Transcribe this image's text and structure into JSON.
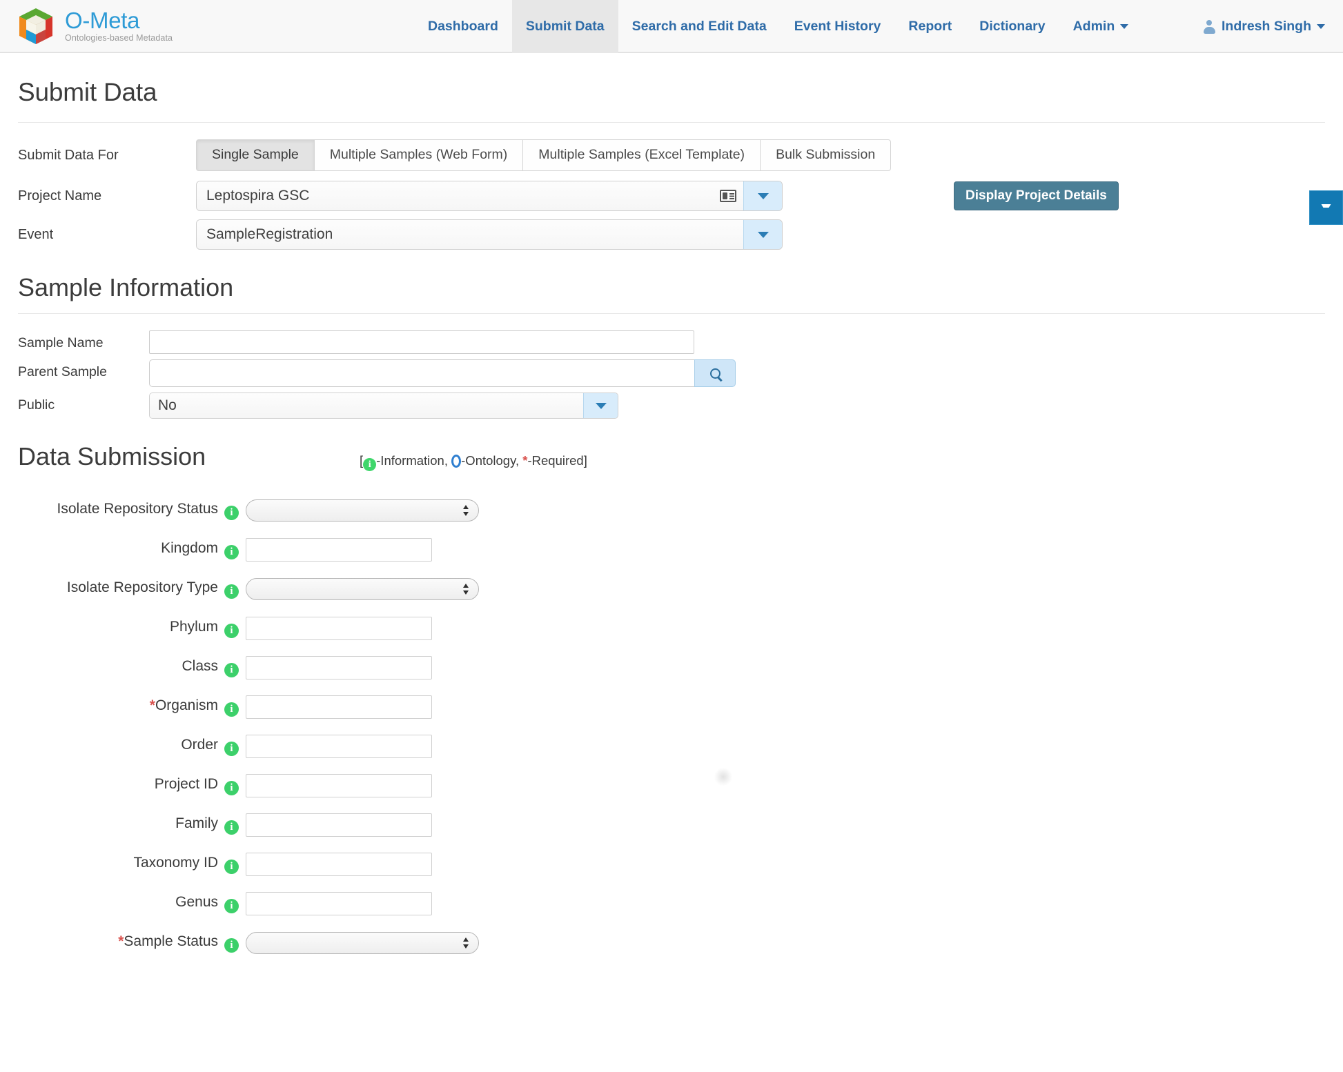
{
  "brand": {
    "title": "O-Meta",
    "subtitle": "Ontologies-based Metadata",
    "logo_colors": {
      "green": "#5aa832",
      "red": "#d6352b",
      "orange": "#f08a1c",
      "blue": "#1f9ad6",
      "cream": "#f2efe2"
    }
  },
  "nav": {
    "items": [
      {
        "label": "Dashboard",
        "active": false
      },
      {
        "label": "Submit Data",
        "active": true
      },
      {
        "label": "Search and Edit Data",
        "active": false
      },
      {
        "label": "Event History",
        "active": false
      },
      {
        "label": "Report",
        "active": false
      },
      {
        "label": "Dictionary",
        "active": false
      },
      {
        "label": "Admin",
        "active": false,
        "has_caret": true
      }
    ],
    "user": {
      "name": "Indresh Singh",
      "icon": "user-icon",
      "has_caret": true
    },
    "link_color": "#2f6ca8",
    "active_bg": "#e7e7e7"
  },
  "page": {
    "title": "Submit Data",
    "collapse_button": {
      "icon": "chevron-down-icon",
      "color": "#1279b3"
    }
  },
  "submit_for": {
    "label": "Submit Data For",
    "tabs": [
      {
        "label": "Single Sample",
        "selected": true
      },
      {
        "label": "Multiple Samples (Web Form)",
        "selected": false
      },
      {
        "label": "Multiple Samples (Excel Template)",
        "selected": false
      },
      {
        "label": "Bulk Submission",
        "selected": false
      }
    ]
  },
  "project": {
    "label": "Project Name",
    "value": "Leptospira GSC",
    "picker_icon": "contact-card-icon",
    "dropdown_icon": "caret-down-icon",
    "details_button": "Display Project Details",
    "details_button_color": "#4b7f96"
  },
  "event": {
    "label": "Event",
    "value": "SampleRegistration",
    "dropdown_icon": "caret-down-icon"
  },
  "sample_information": {
    "title": "Sample Information",
    "sample_name": {
      "label": "Sample Name",
      "value": ""
    },
    "parent_sample": {
      "label": "Parent Sample",
      "value": "",
      "search_icon": "search-icon"
    },
    "public": {
      "label": "Public",
      "value": "No",
      "dropdown_icon": "caret-down-icon"
    }
  },
  "data_submission": {
    "title": "Data Submission",
    "legend": {
      "open_bracket": "[",
      "info_icon": "info-icon",
      "info_text": "-Information,",
      "ontology_icon": "ontology-icon",
      "ontology_text": "-Ontology,",
      "required_mark": "*",
      "required_text": "-Required]"
    },
    "fields": [
      {
        "label": "Isolate Repository Status",
        "required": false,
        "type": "select",
        "value": "",
        "info_icon": "info-icon"
      },
      {
        "label": "Kingdom",
        "required": false,
        "type": "text",
        "value": "",
        "info_icon": "info-icon"
      },
      {
        "label": "Isolate Repository Type",
        "required": false,
        "type": "select",
        "value": "",
        "info_icon": "info-icon"
      },
      {
        "label": "Phylum",
        "required": false,
        "type": "text",
        "value": "",
        "info_icon": "info-icon"
      },
      {
        "label": "Class",
        "required": false,
        "type": "text",
        "value": "",
        "info_icon": "info-icon"
      },
      {
        "label": "Organism",
        "required": true,
        "type": "text",
        "value": "",
        "info_icon": "info-icon"
      },
      {
        "label": "Order",
        "required": false,
        "type": "text",
        "value": "",
        "info_icon": "info-icon"
      },
      {
        "label": "Project ID",
        "required": false,
        "type": "text",
        "value": "",
        "info_icon": "info-icon"
      },
      {
        "label": "Family",
        "required": false,
        "type": "text",
        "value": "",
        "info_icon": "info-icon"
      },
      {
        "label": "Taxonomy ID",
        "required": false,
        "type": "text",
        "value": "",
        "info_icon": "info-icon"
      },
      {
        "label": "Genus",
        "required": false,
        "type": "text",
        "value": "",
        "info_icon": "info-icon"
      },
      {
        "label": "Sample Status",
        "required": true,
        "type": "select",
        "value": "",
        "info_icon": "info-icon"
      }
    ]
  }
}
